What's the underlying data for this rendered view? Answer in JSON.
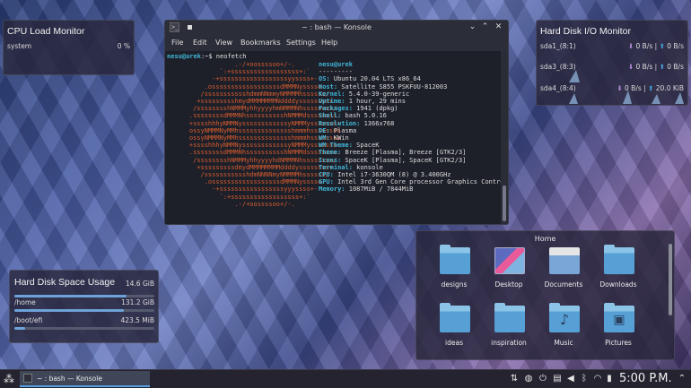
{
  "cpu_widget": {
    "title": "CPU Load Monitor",
    "label": "system",
    "value": "0 %"
  },
  "io_widget": {
    "title": "Hard Disk I/O Monitor",
    "rows": [
      {
        "name": "sda1_(8:1)",
        "read": "0 B/s",
        "write": "0 B/s"
      },
      {
        "name": "sda3_(8:3)",
        "read": "0 B/s",
        "write": "0 B/s"
      },
      {
        "name": "sda4_(8:4)",
        "read": "0 B/s",
        "write": "20.0 KiB"
      }
    ]
  },
  "space_widget": {
    "title": "Hard Disk Space Usage",
    "total": "14.6 GiB",
    "mounts": [
      {
        "path": "/home",
        "size": "131.2 GiB",
        "fill": 0.78
      },
      {
        "path": "/boot/efi",
        "size": "423.5 MiB",
        "fill": 0.08
      }
    ]
  },
  "konsole": {
    "title": "~ : bash — Konsole",
    "menu": [
      "File",
      "Edit",
      "View",
      "Bookmarks",
      "Settings",
      "Help"
    ],
    "prompt_user": "nesu@urek",
    "prompt_rest": ":~$ neofetch",
    "logo_lines": [
      "                .-/+oossssoo+/-.",
      "            `:+ssssssssssssssssss+:`",
      "          -+ssssssssssssssssssyyssss+-",
      "        .ossssssssssssssssssdMMMNysssso.",
      "       /ssssssssssshdmmNNmmyNMMMMhssssss/",
      "      +ssssssssshmydMMMMMMMNddddyssssssss+",
      "     /sssssssshNMMMyhhyyyyhmNMMMNhssssssss/",
      "    .ssssssssdMMMNhsssssssssshNMMMdssssssss.",
      "    +sssshhhyNMMNyssssssssssssyNMMMysssssss+",
      "    ossyNMMMNyMMhsssssssssssssshmmmhssssssso",
      "    ossyNMMMNyMMhsssssssssssssshmmmhssssssso",
      "    +sssshhhyNMMNyssssssssssssyNMMMysssssss+",
      "    .ssssssssdMMMNhsssssssssshNMMMdssssssss.",
      "     /sssssssshNMMMyhhyyyyhdNMMMNhssssssss/",
      "      +sssssssssdmydMMMMMMMMddddyssssssss+",
      "       /ssssssssssshdmNNNNmyNMMMMhssssss/",
      "        .ossssssssssssssssssdMMMNysssso.",
      "          -+sssssssssssssssssyyyssss+-",
      "            `:+ssssssssssssssssss+:`",
      "                .-/+oossssoo+/-."
    ],
    "info_title": "nesu@urek",
    "info_sep": "---------",
    "info": [
      {
        "k": "OS",
        "v": "Ubuntu 20.04 LTS x86_64"
      },
      {
        "k": "Host",
        "v": "Satellite S855 PSKFUU-812003"
      },
      {
        "k": "Kernel",
        "v": "5.4.0-39-generic"
      },
      {
        "k": "Uptime",
        "v": "1 hour, 29 mins"
      },
      {
        "k": "Packages",
        "v": "1941 (dpkg)"
      },
      {
        "k": "Shell",
        "v": "bash 5.0.16"
      },
      {
        "k": "Resolution",
        "v": "1366x768"
      },
      {
        "k": "DE",
        "v": "Plasma"
      },
      {
        "k": "WM",
        "v": "KWin"
      },
      {
        "k": "WM Theme",
        "v": "SpaceK"
      },
      {
        "k": "Theme",
        "v": "Breeze [Plasma], Breeze [GTK2/3]"
      },
      {
        "k": "Icons",
        "v": "SpaceK [Plasma], SpaceK [GTK2/3]"
      },
      {
        "k": "Terminal",
        "v": "konsole"
      },
      {
        "k": "CPU",
        "v": "Intel i7-3630QM (8) @ 3.400GHz"
      },
      {
        "k": "GPU",
        "v": "Intel 3rd Gen Core processor Graphics Contro"
      },
      {
        "k": "Memory",
        "v": "1087MiB / 7844MiB"
      }
    ],
    "swatch_colors_top": [
      "#2e3440",
      "#c0504d",
      "#6a9f55",
      "#c9a64a",
      "#4f81bd",
      "#a05ca8",
      "#3fa5b8",
      "#d9d9d9"
    ],
    "swatch_colors_bottom": [
      "#5c5f6a",
      "#e06c75",
      "#98c379",
      "#e5c07b",
      "#61afef",
      "#c678dd",
      "#56b6c2",
      "#ffffff"
    ]
  },
  "home_view": {
    "title": "Home",
    "items": [
      {
        "label": "designs",
        "kind": "folder"
      },
      {
        "label": "Desktop",
        "kind": "desktop"
      },
      {
        "label": "Documents",
        "kind": "documents"
      },
      {
        "label": "Downloads",
        "kind": "folder"
      },
      {
        "label": "ideas",
        "kind": "folder"
      },
      {
        "label": "inspiration",
        "kind": "folder"
      },
      {
        "label": "Music",
        "kind": "music"
      },
      {
        "label": "Pictures",
        "kind": "pictures"
      }
    ]
  },
  "taskbar": {
    "task_label": "~ : bash — Konsole",
    "clock": "5:00 P.M.",
    "tray_icons": [
      "network-icon",
      "updates-icon",
      "power-icon",
      "clipboard-icon",
      "volume-icon",
      "bluetooth-icon",
      "device-icon",
      "wifi-icon",
      "battery-icon",
      "expand-tray-icon"
    ]
  },
  "colors": {
    "accent": "#5aa0e0",
    "prompt": "#3fb6d9",
    "logo": "#d65b2e"
  }
}
